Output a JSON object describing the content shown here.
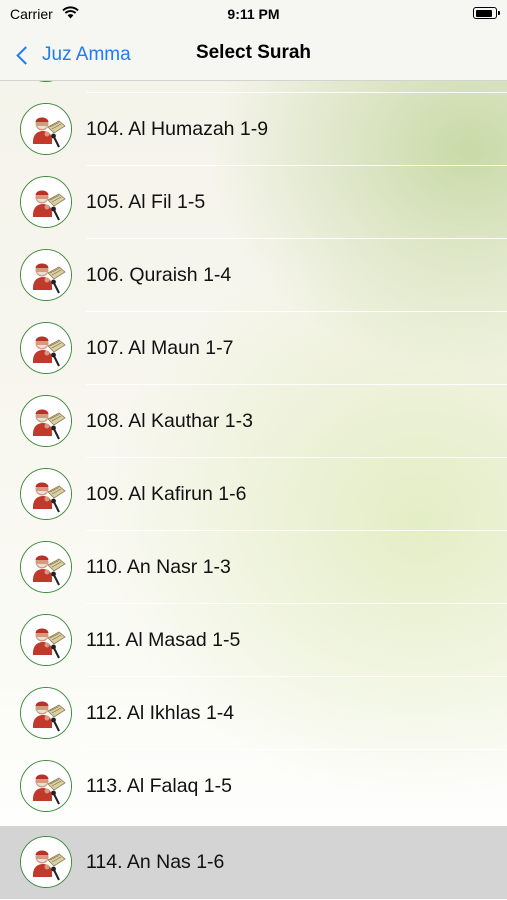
{
  "status_bar": {
    "carrier": "Carrier",
    "time": "9:11 PM",
    "battery_level": 0.9
  },
  "nav": {
    "back_label": "Juz Amma",
    "title": "Select Surah"
  },
  "surahs": [
    {
      "label": "104. Al Humazah 1-9"
    },
    {
      "label": "105. Al Fil 1-5"
    },
    {
      "label": "106. Quraish 1-4"
    },
    {
      "label": "107. Al Maun 1-7"
    },
    {
      "label": "108. Al Kauthar 1-3"
    },
    {
      "label": "109. Al Kafirun 1-6"
    },
    {
      "label": "110. An Nasr 1-3"
    },
    {
      "label": "111. Al Masad 1-5"
    },
    {
      "label": "112. Al Ikhlas 1-4"
    },
    {
      "label": "113. Al Falaq 1-5"
    },
    {
      "label": "114. An Nas 1-6"
    }
  ],
  "selected_index": 10,
  "colors": {
    "accent": "#1f7cf2",
    "avatar_ring": "#3f8a3c",
    "selected_row": "#d4d4d4"
  }
}
